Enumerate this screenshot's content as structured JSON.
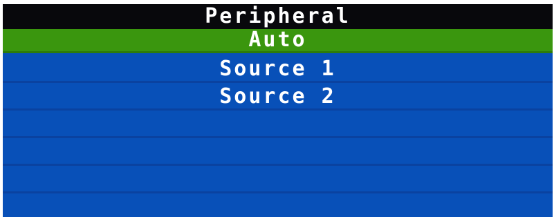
{
  "menu": {
    "title": "Peripheral",
    "items": [
      {
        "label": "Auto",
        "selected": true
      },
      {
        "label": "Source 1",
        "selected": false
      },
      {
        "label": "Source 2",
        "selected": false
      },
      {
        "label": "",
        "selected": false
      },
      {
        "label": "",
        "selected": false
      },
      {
        "label": "",
        "selected": false
      },
      {
        "label": "",
        "selected": false
      }
    ]
  },
  "colors": {
    "background": "#0850b8",
    "title_bar": "#08080c",
    "selected": "#3a960e",
    "text": "#ffffff"
  }
}
